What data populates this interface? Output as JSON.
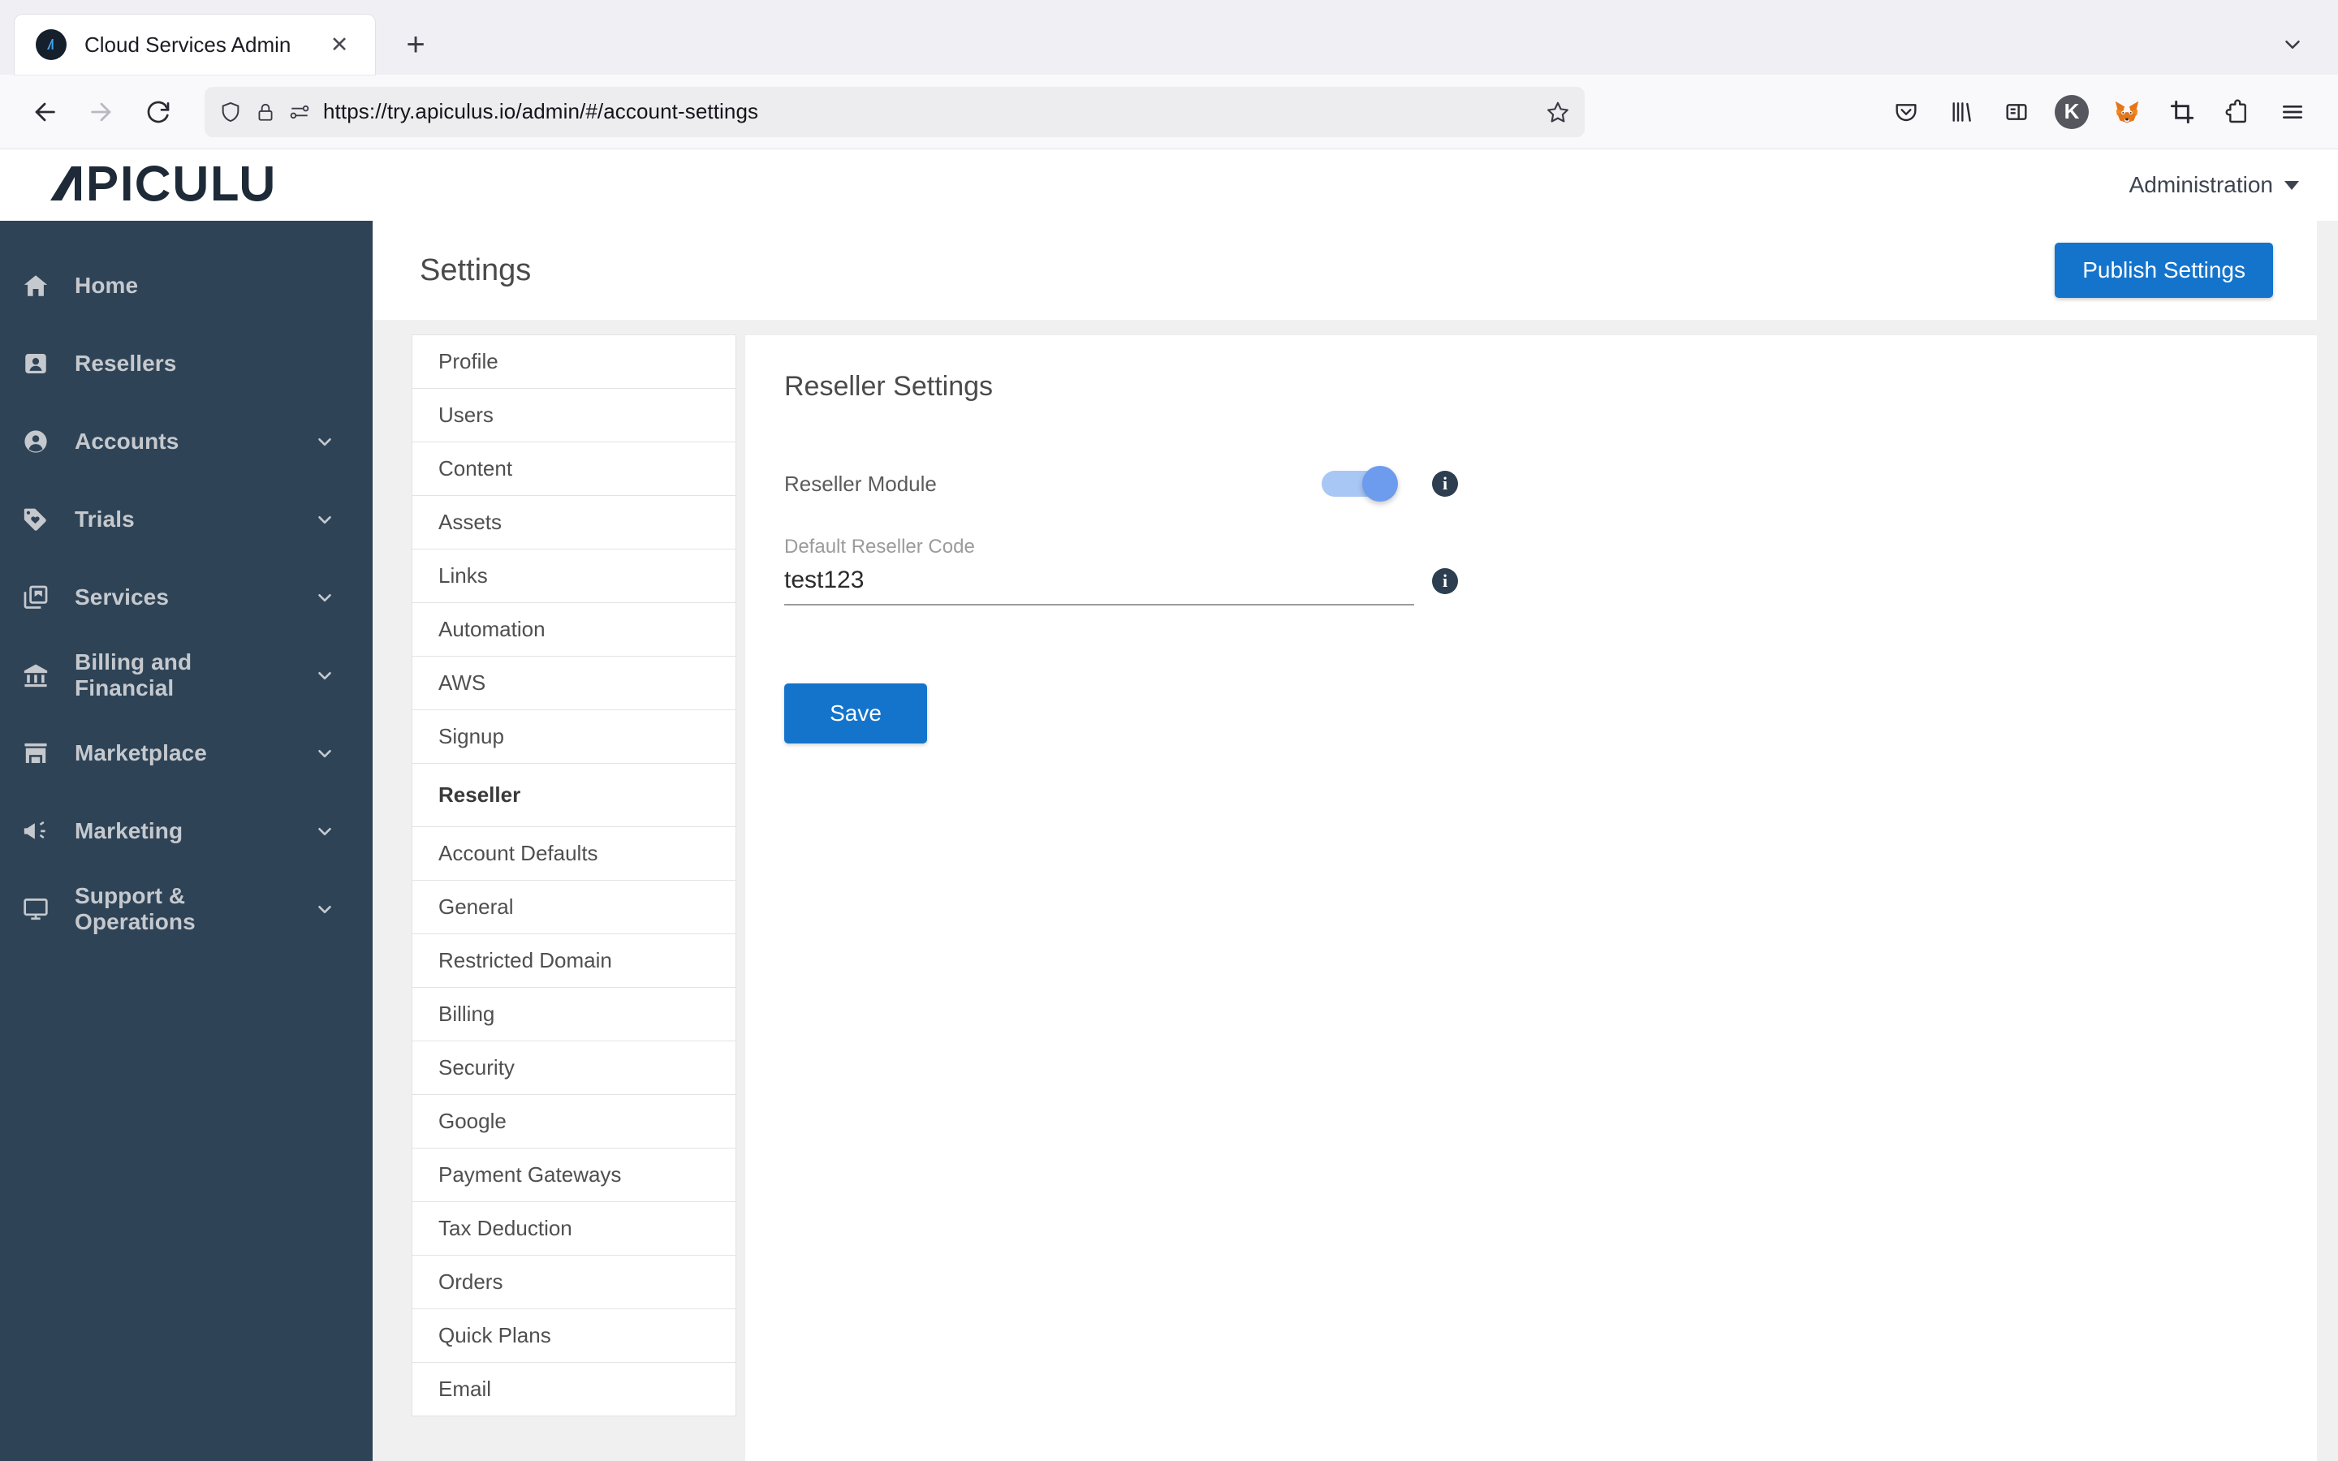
{
  "browser": {
    "tab": {
      "title": "Cloud Services Admin",
      "favicon": "apiculus-logo-icon",
      "close_label": "✕"
    },
    "new_tab_label": "+",
    "nav": {
      "back": "back-icon",
      "forward": "forward-icon",
      "reload": "reload-icon"
    },
    "url": "https://try.apiculus.io/admin/#/account-settings",
    "url_icons": [
      "shield-icon",
      "lock-icon",
      "permissions-icon"
    ],
    "bookmark": "star-icon",
    "toolbar_icons": [
      "pocket-icon",
      "library-icon",
      "sidebar-icon",
      "keepass-icon",
      "metamask-icon",
      "screenshot-icon",
      "extensions-icon",
      "menu-icon"
    ],
    "keepass_letter": "K"
  },
  "app": {
    "logo_text": "APICULUS",
    "account_menu": {
      "label": "Administration",
      "caret": "chevron-down-icon"
    }
  },
  "sidebar": {
    "items": [
      {
        "label": "Home",
        "icon": "home-icon",
        "expandable": false
      },
      {
        "label": "Resellers",
        "icon": "user-card-icon",
        "expandable": false
      },
      {
        "label": "Accounts",
        "icon": "account-circle-icon",
        "expandable": true
      },
      {
        "label": "Trials",
        "icon": "tag-heart-icon",
        "expandable": true
      },
      {
        "label": "Services",
        "icon": "services-stack-icon",
        "expandable": true
      },
      {
        "label": "Billing and Financial",
        "icon": "bank-icon",
        "expandable": true
      },
      {
        "label": "Marketplace",
        "icon": "storefront-icon",
        "expandable": true
      },
      {
        "label": "Marketing",
        "icon": "megaphone-icon",
        "expandable": true
      },
      {
        "label": "Support & Operations",
        "icon": "monitor-icon",
        "expandable": true
      }
    ]
  },
  "settings": {
    "page_title": "Settings",
    "publish_button": "Publish Settings",
    "tabs": [
      {
        "label": "Profile",
        "active": false
      },
      {
        "label": "Users",
        "active": false
      },
      {
        "label": "Content",
        "active": false
      },
      {
        "label": "Assets",
        "active": false
      },
      {
        "label": "Links",
        "active": false
      },
      {
        "label": "Automation",
        "active": false
      },
      {
        "label": "AWS",
        "active": false
      },
      {
        "label": "Signup",
        "active": false
      },
      {
        "label": "Reseller",
        "active": true
      },
      {
        "label": "Account Defaults",
        "active": false
      },
      {
        "label": "General",
        "active": false
      },
      {
        "label": "Restricted Domain",
        "active": false
      },
      {
        "label": "Billing",
        "active": false
      },
      {
        "label": "Security",
        "active": false
      },
      {
        "label": "Google",
        "active": false
      },
      {
        "label": "Payment Gateways",
        "active": false
      },
      {
        "label": "Tax Deduction",
        "active": false
      },
      {
        "label": "Orders",
        "active": false
      },
      {
        "label": "Quick Plans",
        "active": false
      },
      {
        "label": "Email",
        "active": false
      }
    ],
    "panel": {
      "title": "Reseller Settings",
      "toggle_row": {
        "label": "Reseller Module",
        "state": "on",
        "info": "info-icon"
      },
      "code_field": {
        "label": "Default Reseller Code",
        "value": "test123",
        "placeholder": "",
        "info": "info-icon"
      },
      "save_button": "Save"
    }
  },
  "colors": {
    "sidebar_bg": "#2e4356",
    "primary": "#1474cc",
    "toggle_track": "#a9c7f5",
    "toggle_thumb": "#6d9cee",
    "info_bg": "#2c3e50"
  }
}
